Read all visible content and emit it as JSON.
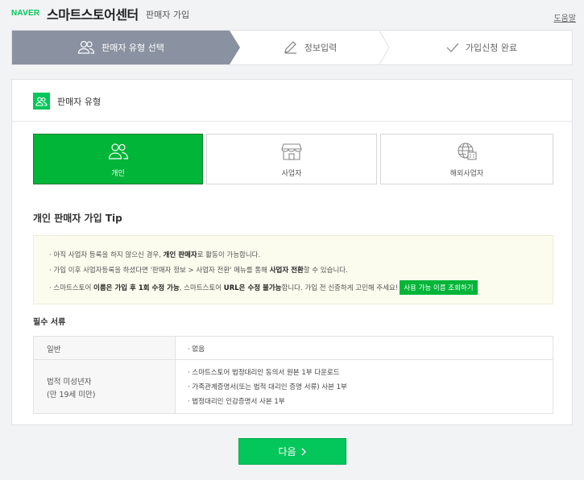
{
  "header": {
    "logo": "NAVER",
    "brand": "스마트스토어센터",
    "sub": "판매자 가입",
    "help": "도움말"
  },
  "steps": [
    {
      "label": "판매자 유형 선택",
      "icon": "users-icon",
      "active": true
    },
    {
      "label": "정보입력",
      "icon": "pencil-icon",
      "active": false
    },
    {
      "label": "가입신청 완료",
      "icon": "check-icon",
      "active": false
    }
  ],
  "card": {
    "title": "판매자 유형",
    "types": [
      {
        "label": "개인",
        "icon": "person-icon",
        "selected": true
      },
      {
        "label": "사업자",
        "icon": "store-icon",
        "selected": false
      },
      {
        "label": "해외사업자",
        "icon": "globe-building-icon",
        "selected": false
      }
    ],
    "tip_title": "개인 판매자 가입 Tip",
    "tips": {
      "line1_a": "· 아직 사업자 등록을 하지 않으신 경우, ",
      "line1_b": "개인 판매자",
      "line1_c": "로 활동이 가능합니다.",
      "line2_a": "· 가입 이후 사업자등록을 하셨다면 '판매자 정보 > 사업자 전환' 메뉴를 통해 ",
      "line2_b": "사업자 전환",
      "line2_c": "할 수 있습니다.",
      "line3_a": "· 스마트스토어 ",
      "line3_b": "이름은 가입 후 1회 수정 가능",
      "line3_c": ", 스마트스토어 ",
      "line3_d": "URL은 수정 불가능",
      "line3_e": "합니다. 가입 전 신중하게 고민해 주세요!",
      "check_button": "사용 가능 이름 조회하기"
    },
    "docs_title": "필수 서류",
    "docs": {
      "row1_label": "일반",
      "row1_value": "· 없음",
      "row2_label1": "법적 미성년자",
      "row2_label2": "(만 19세 미만)",
      "row2_values": [
        "· 스마트스토어 법정대리인 동의서 원본 1부 다운로드",
        "· 가족관계증명서(또는 법적 대리인 증명 서류) 사본 1부",
        "· 법정대리인 인감증명서 사본 1부"
      ]
    }
  },
  "next_button": "다음",
  "colors": {
    "accent": "#03c75a",
    "step_active": "#8a91a0",
    "tip_bg": "#fbfbee"
  }
}
